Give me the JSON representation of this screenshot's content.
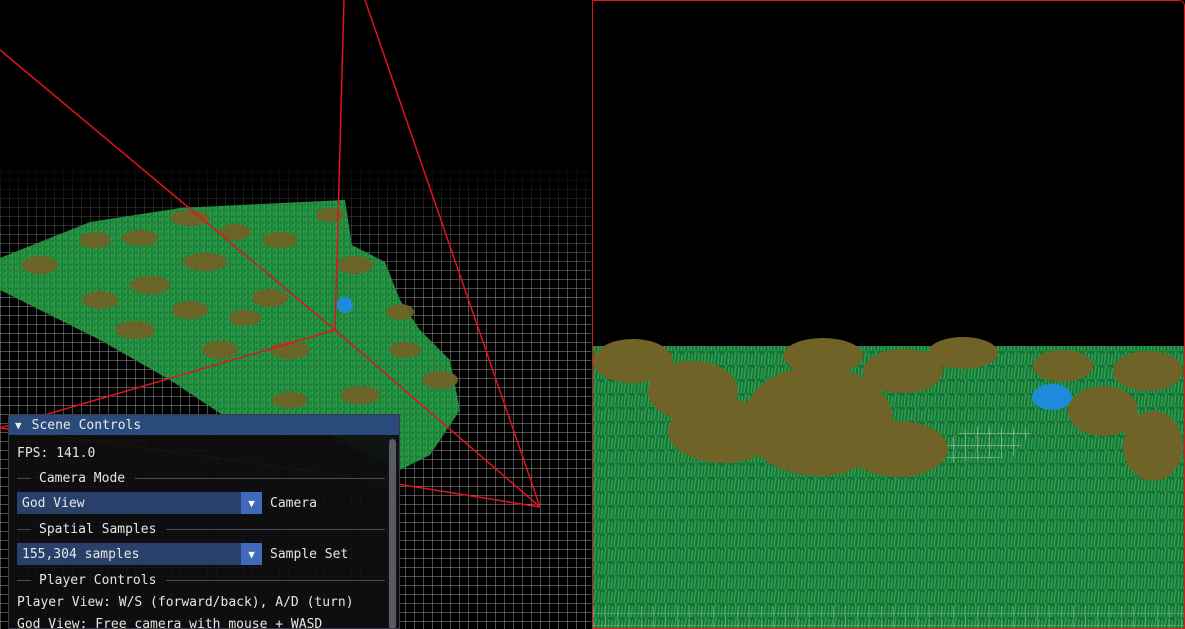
{
  "window": {
    "title": ""
  },
  "colors": {
    "frustum": "#e0141e",
    "grass": "#1f8a3c",
    "shrub": "#7a6a2a",
    "player_sphere": "#1f8ad9",
    "panel_header": "#294a7a",
    "combo_bg": "#29416a",
    "combo_arrow": "#3f6ab8"
  },
  "viewports": {
    "left": {
      "name": "god-view",
      "shows": [
        "grid-floor",
        "grass-field",
        "camera-frustum",
        "player-sphere"
      ]
    },
    "right": {
      "name": "player-view",
      "shows": [
        "grass-field",
        "shrubs",
        "player-sphere"
      ]
    }
  },
  "scene_controls": {
    "title": "Scene Controls",
    "collapse_icon": "triangle-down-icon",
    "fps_label": "FPS:",
    "fps_value": "141.0",
    "camera_mode": {
      "section": "Camera Mode",
      "selected": "God View",
      "label": "Camera"
    },
    "spatial_samples": {
      "section": "Spatial Samples",
      "selected": "155,304 samples",
      "label": "Sample Set"
    },
    "player_controls": {
      "section": "Player Controls",
      "line1": "Player View: W/S (forward/back), A/D (turn)",
      "line2": "God View: Free camera with mouse + WASD"
    }
  }
}
